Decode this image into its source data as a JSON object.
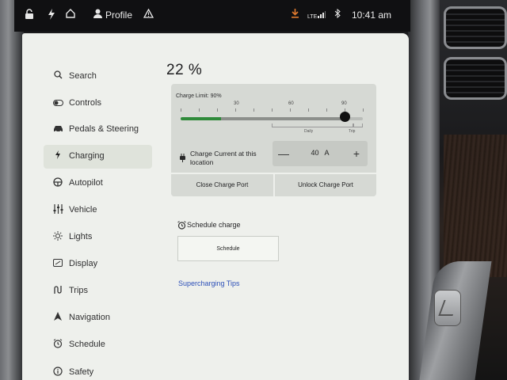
{
  "status_bar": {
    "profile_label": "Profile",
    "network_label": "LTE",
    "time": "10:41 am",
    "icons": [
      "lock-icon",
      "bolt-icon",
      "home-icon",
      "person-icon",
      "warning-icon",
      "download-icon",
      "signal-icon",
      "bluetooth-icon"
    ]
  },
  "sidebar": {
    "items": [
      {
        "label": "Search",
        "icon": "search-icon",
        "active": false
      },
      {
        "label": "Controls",
        "icon": "toggle-icon",
        "active": false
      },
      {
        "label": "Pedals & Steering",
        "icon": "car-icon",
        "active": false
      },
      {
        "label": "Charging",
        "icon": "bolt-icon",
        "active": true
      },
      {
        "label": "Autopilot",
        "icon": "steering-wheel-icon",
        "active": false
      },
      {
        "label": "Vehicle",
        "icon": "sliders-icon",
        "active": false
      },
      {
        "label": "Lights",
        "icon": "sun-icon",
        "active": false
      },
      {
        "label": "Display",
        "icon": "display-icon",
        "active": false
      },
      {
        "label": "Trips",
        "icon": "route-icon",
        "active": false
      },
      {
        "label": "Navigation",
        "icon": "navigation-arrow-icon",
        "active": false
      },
      {
        "label": "Schedule",
        "icon": "clock-icon",
        "active": false
      },
      {
        "label": "Safety",
        "icon": "info-icon",
        "active": false
      }
    ]
  },
  "charging": {
    "battery_level": "22 %",
    "charge_limit_label": "Charge Limit: 90%",
    "charge_limit_value": 90,
    "battery_fraction": 0.22,
    "scale_labels": [
      "30",
      "60",
      "90"
    ],
    "range_labels": {
      "daily": "Daily",
      "trip": "Trip"
    },
    "current_label": "Charge Current at this location",
    "current_value": "40",
    "current_unit": "A",
    "decrement_label": "—",
    "increment_label": "+",
    "close_port_label": "Close Charge Port",
    "unlock_port_label": "Unlock Charge Port"
  },
  "schedule": {
    "title": "Schedule charge",
    "button_label": "Schedule"
  },
  "links": {
    "supercharging_tips": "Supercharging Tips"
  },
  "colors": {
    "screen_bg": "#eef0ec",
    "panel_bg": "#d6d9d4",
    "charge_fill": "#2f8a3a",
    "link": "#2c4fb8",
    "status_bar_bg": "#101012",
    "download_accent": "#e07a2e"
  }
}
